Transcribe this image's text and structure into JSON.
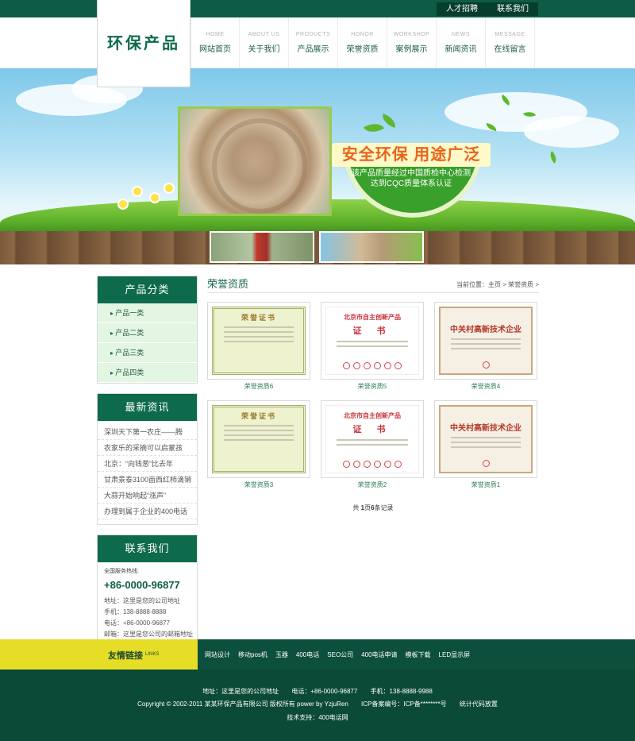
{
  "top_links": [
    {
      "label": "人才招聘"
    },
    {
      "label": "联系我们"
    }
  ],
  "logo": {
    "text": "环保产品"
  },
  "nav": [
    {
      "en": "HOME",
      "cn": "网站首页"
    },
    {
      "en": "ABOUT US",
      "cn": "关于我们"
    },
    {
      "en": "PRODUCTS",
      "cn": "产品展示"
    },
    {
      "en": "HONOR",
      "cn": "荣誉资质"
    },
    {
      "en": "WORKSHOP",
      "cn": "案例展示"
    },
    {
      "en": "NEWS",
      "cn": "新闻资讯"
    },
    {
      "en": "MESSAGE",
      "cn": "在线留言"
    }
  ],
  "banner": {
    "slogan": "安全环保 用途广泛",
    "sub1": "该产品质量经过中国质检中心检测",
    "sub2": "达到CQC质量体系认证"
  },
  "categories": {
    "title": "产品分类",
    "items": [
      "产品一类",
      "产品二类",
      "产品三类",
      "产品四类"
    ]
  },
  "news": {
    "title": "最新资讯",
    "items": [
      "深圳天下第一农庄——腾",
      "农家乐的采摘可以启蒙孩",
      "北京：“向钱葱”比去年",
      "甘肃景泰3100亩西红柿滴销",
      "大蒜开始响起“涨声”",
      "办理到属于企业的400电话"
    ]
  },
  "contact": {
    "title": "联系我们",
    "hotline_label": "全国服务热线:",
    "hotline": "+86-0000-96877",
    "lines": [
      "地址：这里是您的公司地址",
      "手机：138-8888-8888",
      "电话：+86-0000-96877",
      "邮箱：这里是您公司的邮箱地址"
    ]
  },
  "main": {
    "title": "荣誉资质",
    "breadcrumb": "当前位置：主页 > 荣誉资质 >",
    "certs": [
      {
        "caption": "荣誉资质6",
        "kind": "a",
        "heading": "荣誉证书",
        "heading2": ""
      },
      {
        "caption": "荣誉资质5",
        "kind": "b",
        "heading": "北京市自主创新产品",
        "heading2": "证 书"
      },
      {
        "caption": "荣誉资质4",
        "kind": "c",
        "heading": "中关村高新技术企业",
        "heading2": ""
      },
      {
        "caption": "荣誉资质3",
        "kind": "a",
        "heading": "荣誉证书",
        "heading2": ""
      },
      {
        "caption": "荣誉资质2",
        "kind": "b",
        "heading": "北京市自主创新产品",
        "heading2": "证 书"
      },
      {
        "caption": "荣誉资质1",
        "kind": "c",
        "heading": "中关村高新技术企业",
        "heading2": ""
      }
    ],
    "paging": {
      "prefix": "共 ",
      "page": "1",
      "mid": "页",
      "count": "6",
      "suffix": "条记录"
    }
  },
  "friend_links": {
    "label": "友情链接",
    "label_en": "LINKS",
    "items": [
      "网站设计",
      "移动pos机",
      "玉器",
      "400电话",
      "SEO公司",
      "400电话申请",
      "模板下载",
      "LED显示屏"
    ]
  },
  "footer": {
    "address": "地址：这里是您的公司地址",
    "phone": "电话：+86-0000-96877",
    "mobile": "手机：138-8888-9988",
    "copyright": "Copyright © 2002-2011 某某环保产品有限公司 版权所有 power by YzjuRen",
    "icp": "ICP备案编号：ICP备********号",
    "stats": "统计代码放置",
    "support": "技术支持：400电话网"
  },
  "colors": {
    "brand_green": "#0e6a4c",
    "dark_green": "#0b4a36",
    "accent_yellow": "#e6dd26",
    "slogan_orange": "#e8641a"
  }
}
